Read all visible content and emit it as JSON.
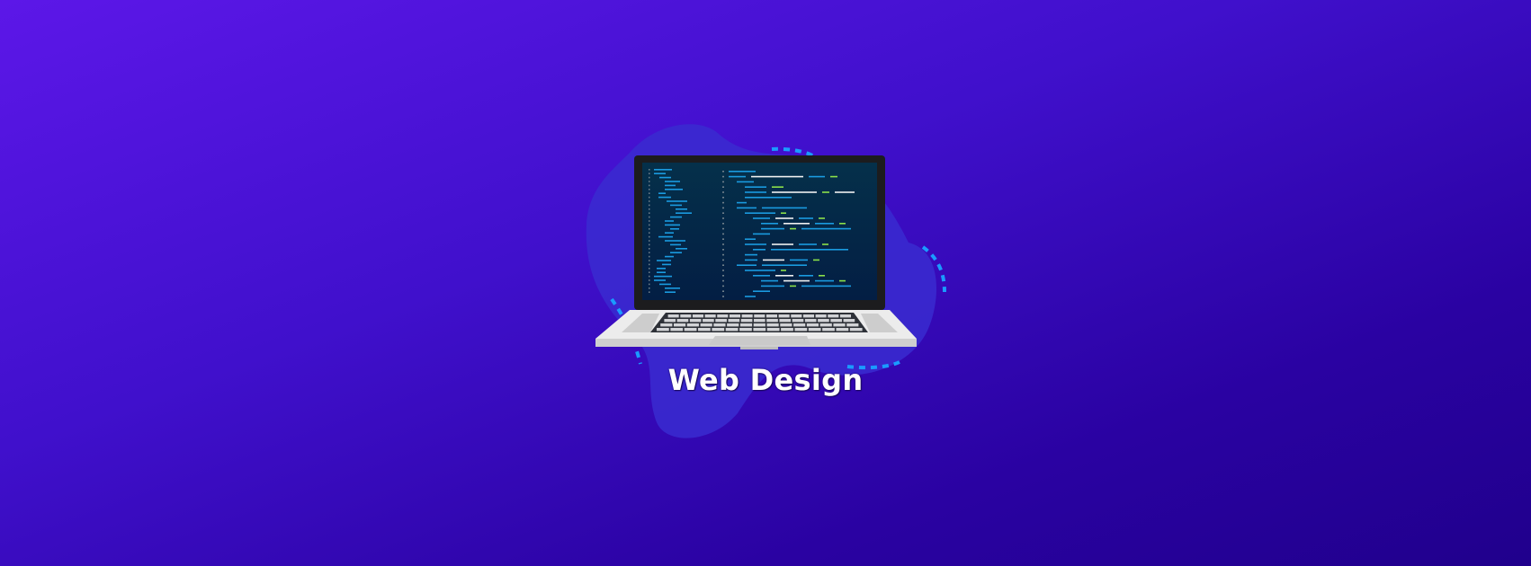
{
  "banner": {
    "title": "Web Design"
  },
  "colors": {
    "background_start": "#5c17e8",
    "background_end": "#20008c",
    "blob": "#3a2bd0",
    "dashed_accent": "#1a9bff",
    "code_blue": "#1a9be0",
    "code_white": "#f0f0f0",
    "code_green": "#8be04a",
    "screen": "#05264a"
  },
  "illustration": {
    "subject": "laptop-with-code-editor"
  }
}
